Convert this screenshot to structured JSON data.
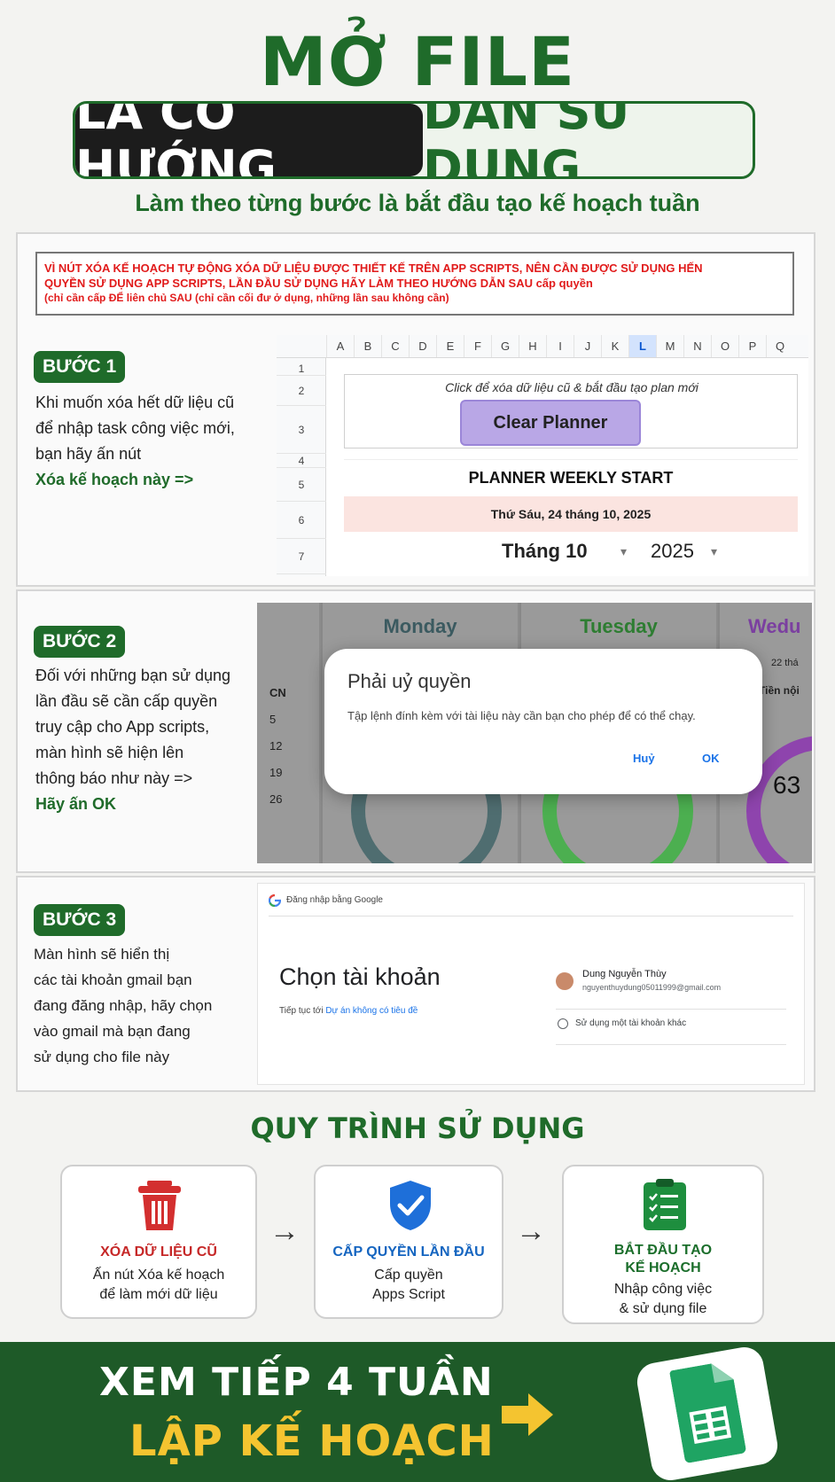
{
  "header": {
    "title_top": "MỞ FILE",
    "title_dark": "LÀ CÓ HƯỚNG",
    "title_light": "DẪN SỬ DỤNG",
    "subtitle": "Làm theo từng bước là bắt đầu tạo kế hoạch tuần"
  },
  "warning": {
    "line1": "VÌ NÚT XÓA KẾ HOẠCH TỰ ĐỘNG XÓA DỮ LIỆU ĐƯỢC THIẾT KẾ TRÊN APP SCRIPTS, NÊN CẦN ĐƯỢC SỬ DỤNG HẾN",
    "line2": "QUYỀN SỬ DỤNG APP SCRIPTS, LẦN ĐẦU SỬ DỤNG HÃY LÀM THEO HƯỚNG DẪN SAU cấp quyền",
    "line3": "(chỉ cần cấp ĐỂ liên chủ SAU (chỉ cần cối đư ở dụng, những lần sau không cần)"
  },
  "step1": {
    "badge": "BƯỚC 1",
    "text1": "Khi muốn xóa hết dữ liệu cũ",
    "text2": "để nhập task công việc mới,",
    "text3": "bạn hãy ấn nút",
    "highlight": "Xóa kế hoạch này =>"
  },
  "sheet": {
    "columns": [
      "A",
      "B",
      "C",
      "D",
      "E",
      "F",
      "G",
      "H",
      "I",
      "J",
      "K",
      "L",
      "M",
      "N",
      "O",
      "P",
      "Q"
    ],
    "rows": [
      "1",
      "2",
      "3",
      "4",
      "5",
      "6",
      "7"
    ],
    "caption": "Click để xóa dữ liệu cũ & bắt đầu tạo plan mới",
    "button": "Clear Planner",
    "planner_title": "PLANNER WEEKLY START",
    "date": "Thứ Sáu, 24 tháng 10, 2025",
    "month": "Tháng 10",
    "year": "2025",
    "dropdown": "▾"
  },
  "step2": {
    "badge": "BƯỚC 2",
    "text1": "Đối với những bạn sử dụng",
    "text2": "lần đầu sẽ cần cấp quyền",
    "text3": "truy cập cho App scripts,",
    "text4": "màn hình sẽ hiện lên",
    "text5": "thông báo như này =>",
    "highlight": "Hãy ấn OK"
  },
  "dashboard": {
    "day1": "Monday",
    "day2": "Tuesday",
    "day3": "Wedu",
    "row_label": "CN",
    "row_nums": [
      "5",
      "12",
      "19",
      "26"
    ],
    "right_top": "22 thá",
    "right_label": "Tiền nội",
    "right_num": "63"
  },
  "dialog": {
    "title": "Phải uỷ quyền",
    "body": "Tập lệnh đính kèm với tài liệu này cần bạn cho phép để có thể chạy.",
    "cancel": "Huỷ",
    "ok": "OK"
  },
  "step3": {
    "badge": "BƯỚC 3",
    "text1": "Màn hình sẽ hiển thị",
    "text2": "các tài khoản gmail bạn",
    "text3": "đang đăng nhập, hãy chọn",
    "text4": "vào gmail mà bạn đang",
    "text5": "sử dụng cho file này"
  },
  "google": {
    "header": "Đăng nhập bằng Google",
    "title": "Chọn tài khoản",
    "continue_prefix": "Tiếp tục tới ",
    "project": "Dự án không có tiêu đề",
    "account_name": "Dung Nguyễn Thùy",
    "account_email": "nguyenthuydung05011999@gmail.com",
    "other": "Sử dụng một tài khoản khác"
  },
  "process": {
    "title": "QUY TRÌNH SỬ DỤNG",
    "card1_title": "XÓA DỮ LIỆU CŨ",
    "card1_desc1": "Ấn nút Xóa kế hoạch",
    "card1_desc2": "để làm mới dữ liệu",
    "card2_title": "CẤP QUYỀN LẦN ĐẦU",
    "card2_desc1": "Cấp quyền",
    "card2_desc2": "Apps Script",
    "card3_title1": "BẮT ĐẦU TẠO",
    "card3_title2": "KẾ HOẠCH",
    "card3_desc1": "Nhập công việc",
    "card3_desc2": "& sử dụng file"
  },
  "footer": {
    "line1": "XEM TIẾP 4 TUẦN",
    "line2": "LẬP KẾ HOẠCH"
  },
  "colors": {
    "brand_green": "#1f6b2a",
    "warning_red": "#e11b1b",
    "footer_yellow": "#f4c430",
    "button_purple": "#b9a7e6"
  }
}
